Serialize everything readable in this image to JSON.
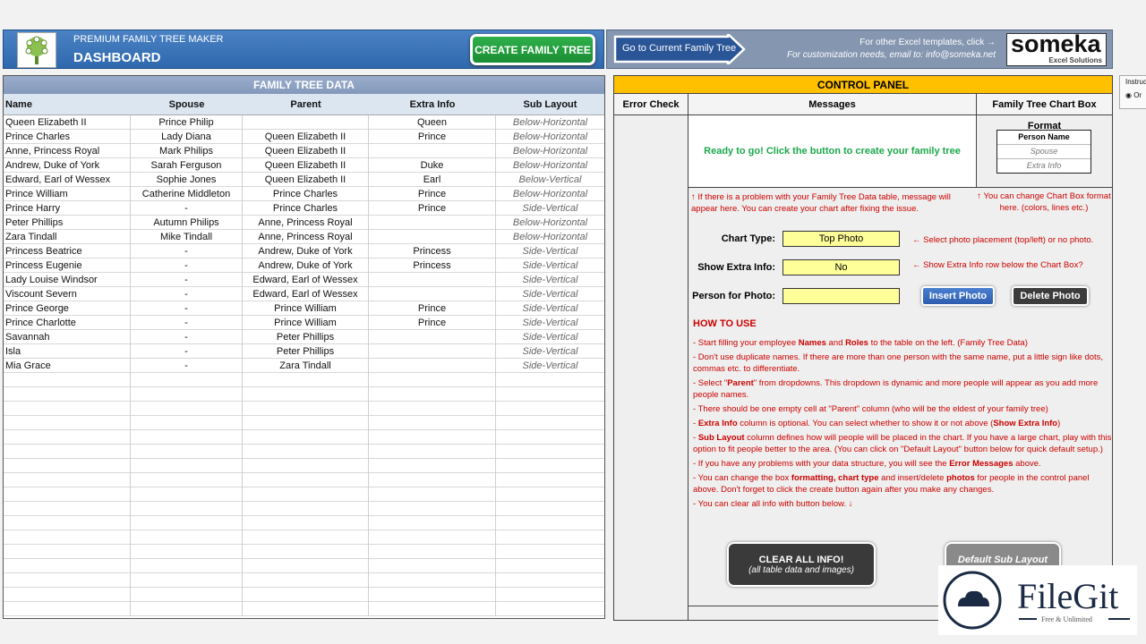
{
  "header": {
    "subtitle": "PREMIUM FAMILY TREE MAKER",
    "title": "DASHBOARD",
    "create_button": "CREATE FAMILY TREE",
    "goto_button": "Go to Current Family Tree",
    "templates_text": "For other Excel templates, click →",
    "email_text": "For customization needs, email to: info@someka.net",
    "brand": "someka",
    "brand_sub": "Excel Solutions"
  },
  "table": {
    "title": "FAMILY TREE DATA",
    "columns": [
      "Name",
      "Spouse",
      "Parent",
      "Extra Info",
      "Sub Layout"
    ],
    "rows": [
      [
        "Queen Elizabeth II",
        "Prince Philip",
        "",
        "Queen",
        "Below-Horizontal"
      ],
      [
        "Prince Charles",
        "Lady Diana",
        "Queen Elizabeth II",
        "Prince",
        "Below-Horizontal"
      ],
      [
        "Anne, Princess Royal",
        "Mark Philips",
        "Queen Elizabeth II",
        "",
        "Below-Horizontal"
      ],
      [
        "Andrew, Duke of York",
        "Sarah Ferguson",
        "Queen Elizabeth II",
        "Duke",
        "Below-Horizontal"
      ],
      [
        "Edward, Earl of Wessex",
        "Sophie Jones",
        "Queen Elizabeth II",
        "Earl",
        "Below-Vertical"
      ],
      [
        "Prince William",
        "Catherine Middleton",
        "Prince Charles",
        "Prince",
        "Below-Horizontal"
      ],
      [
        "Prince Harry",
        "-",
        "Prince Charles",
        "Prince",
        "Side-Vertical"
      ],
      [
        "Peter Phillips",
        "Autumn Philips",
        "Anne, Princess Royal",
        "",
        "Below-Horizontal"
      ],
      [
        "Zara Tindall",
        "Mike Tindall",
        "Anne, Princess Royal",
        "",
        "Below-Horizontal"
      ],
      [
        "Princess Beatrice",
        "-",
        "Andrew, Duke of York",
        "Princess",
        "Side-Vertical"
      ],
      [
        "Princess Eugenie",
        "-",
        "Andrew, Duke of York",
        "Princess",
        "Side-Vertical"
      ],
      [
        "Lady Louise Windsor",
        "-",
        "Edward, Earl of Wessex",
        "",
        "Side-Vertical"
      ],
      [
        "Viscount Severn",
        "-",
        "Edward, Earl of Wessex",
        "",
        "Side-Vertical"
      ],
      [
        "Prince George",
        "-",
        "Prince William",
        "Prince",
        "Side-Vertical"
      ],
      [
        "Prince Charlotte",
        "-",
        "Prince William",
        "Prince",
        "Side-Vertical"
      ],
      [
        "Savannah",
        "-",
        "Peter Phillips",
        "",
        "Side-Vertical"
      ],
      [
        "Isla",
        "-",
        "Peter Phillips",
        "",
        "Side-Vertical"
      ],
      [
        "Mia Grace",
        "-",
        "Zara Tindall",
        "",
        "Side-Vertical"
      ]
    ]
  },
  "control": {
    "title": "CONTROL PANEL",
    "col_error": "Error Check",
    "col_messages": "Messages",
    "col_format": "Family Tree Chart Box Format",
    "message": "Ready to go! Click the button to create your family tree",
    "format_box": [
      "Person Name",
      "Spouse",
      "Extra Info"
    ],
    "note_error": "↑  If there is a problem with your Family Tree Data table, message will appear here. You can create your chart after fixing the issue.",
    "note_format": "↑  You can change Chart Box format here. (colors, lines etc.)",
    "chart_type_label": "Chart Type:",
    "chart_type_value": "Top Photo",
    "chart_type_hint": "←  Select photo placement (top/left) or no photo.",
    "extra_label": "Show Extra Info:",
    "extra_value": "No",
    "extra_hint": "←  Show Extra Info row below the Chart Box?",
    "photo_label": "Person for Photo:",
    "photo_value": "",
    "insert_photo": "Insert Photo",
    "delete_photo": "Delete Photo",
    "howto_title": "HOW TO USE",
    "howto": [
      [
        [
          "- Start filling your employee ",
          0
        ],
        [
          "Names",
          1
        ],
        [
          " and ",
          0
        ],
        [
          "Roles",
          1
        ],
        [
          " to the table on the left. (Family Tree Data)",
          0
        ]
      ],
      [
        [
          "- Don't use duplicate names. If there are more than one person with the same name, put a little sign like dots, commas etc. to differentiate.",
          0
        ]
      ],
      [
        [
          "- Select \"",
          0
        ],
        [
          "Parent",
          1
        ],
        [
          "\" from dropdowns. This dropdown is dynamic and more people will appear as you add more people names.",
          0
        ]
      ],
      [
        [
          "- There should be one empty cell at \"Parent\" column (who will be the eldest of your family tree)",
          0
        ]
      ],
      [
        [
          "- ",
          0
        ],
        [
          "Extra Info",
          1
        ],
        [
          " column is optional. You can select whether to show it or not above (",
          0
        ],
        [
          "Show Extra Info",
          1
        ],
        [
          ")",
          0
        ]
      ],
      [
        [
          "- ",
          0
        ],
        [
          "Sub Layout",
          1
        ],
        [
          " column defines how will people will be placed in the chart. If you have a large chart, play with this option to fit people better to the area. (You can click on \"Default Layout\" button below for quick default setup.)",
          0
        ]
      ],
      [
        [
          "- If you have any problems with your data structure, you will see the ",
          0
        ],
        [
          "Error Messages",
          1
        ],
        [
          " above.",
          0
        ]
      ],
      [
        [
          "- You can change the box ",
          0
        ],
        [
          "formatting, chart type",
          1
        ],
        [
          " and insert/delete ",
          0
        ],
        [
          "photos",
          1
        ],
        [
          " for people in the control panel above. Don't forget to click the create button again after you make any changes.",
          0
        ]
      ],
      [
        [
          "- You can clear all info with button below. ↓",
          0
        ]
      ]
    ],
    "clear_title": "CLEAR ALL INFO!",
    "clear_sub": "(all table data and images)",
    "default_layout": "Default Sub Layout"
  },
  "side": {
    "instructions": "Instruc",
    "option": "Or"
  },
  "watermark": {
    "name": "FileGit",
    "tagline": "Free & Unlimited"
  }
}
